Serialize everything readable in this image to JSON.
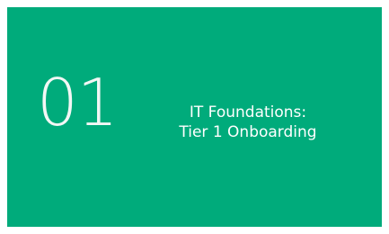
{
  "card": {
    "number": "01",
    "title_line1": "IT Foundations:",
    "title_line2": "Tier 1 Onboarding",
    "background_color": "#00ab7b",
    "text_color": "#ffffff"
  }
}
